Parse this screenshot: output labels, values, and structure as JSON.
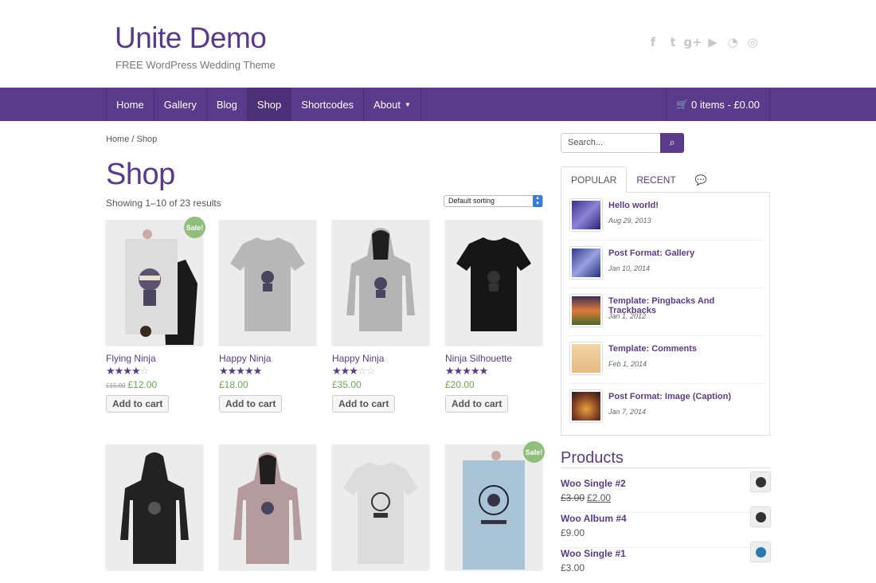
{
  "header": {
    "site_title": "Unite Demo",
    "site_description": "FREE WordPress Wedding Theme",
    "social_icons": [
      "facebook-icon",
      "twitter-icon",
      "google-plus-icon",
      "youtube-icon",
      "rss-icon",
      "dribbble-icon"
    ]
  },
  "nav": {
    "items": [
      {
        "label": "Home"
      },
      {
        "label": "Gallery"
      },
      {
        "label": "Blog"
      },
      {
        "label": "Shop"
      },
      {
        "label": "Shortcodes"
      },
      {
        "label": "About"
      }
    ],
    "active": "Shop",
    "cart": "0 items - £0.00"
  },
  "breadcrumb": "Home / Shop",
  "page_title": "Shop",
  "result_count": "Showing 1–10 of 23 results",
  "sorting": {
    "selected": "Default sorting"
  },
  "sale_badge": "Sale!",
  "add_to_cart": "Add to cart",
  "products": [
    {
      "name": "Flying Ninja",
      "rating": 4,
      "old_price": "£15.00",
      "price": "£12.00",
      "sale": true
    },
    {
      "name": "Happy Ninja",
      "rating": 5,
      "price": "£18.00"
    },
    {
      "name": "Happy Ninja",
      "rating": 3,
      "price": "£35.00"
    },
    {
      "name": "Ninja Silhouette",
      "rating": 5,
      "price": "£20.00"
    }
  ],
  "search": {
    "placeholder": "Search..."
  },
  "tabs": {
    "popular": "POPULAR",
    "recent": "RECENT"
  },
  "posts": [
    {
      "title": "Hello world!",
      "date": "Aug 29, 2013"
    },
    {
      "title": "Post Format: Gallery",
      "date": "Jan 10, 2014"
    },
    {
      "title": "Template: Pingbacks And Trackbacks",
      "date": "Jan 1, 2012"
    },
    {
      "title": "Template: Comments",
      "date": "Feb 1, 2014"
    },
    {
      "title": "Post Format: Image (Caption)",
      "date": "Jan 7, 2014"
    }
  ],
  "products_widget": {
    "title": "Products",
    "items": [
      {
        "name": "Woo Single #2",
        "old_price": "£3.00",
        "price": "£2.00"
      },
      {
        "name": "Woo Album #4",
        "price": "£9.00"
      },
      {
        "name": "Woo Single #1",
        "price": "£3.00"
      }
    ]
  },
  "colors": {
    "accent": "#5a3a8a",
    "price": "#6aa84f",
    "sale": "#8fbf7a"
  }
}
